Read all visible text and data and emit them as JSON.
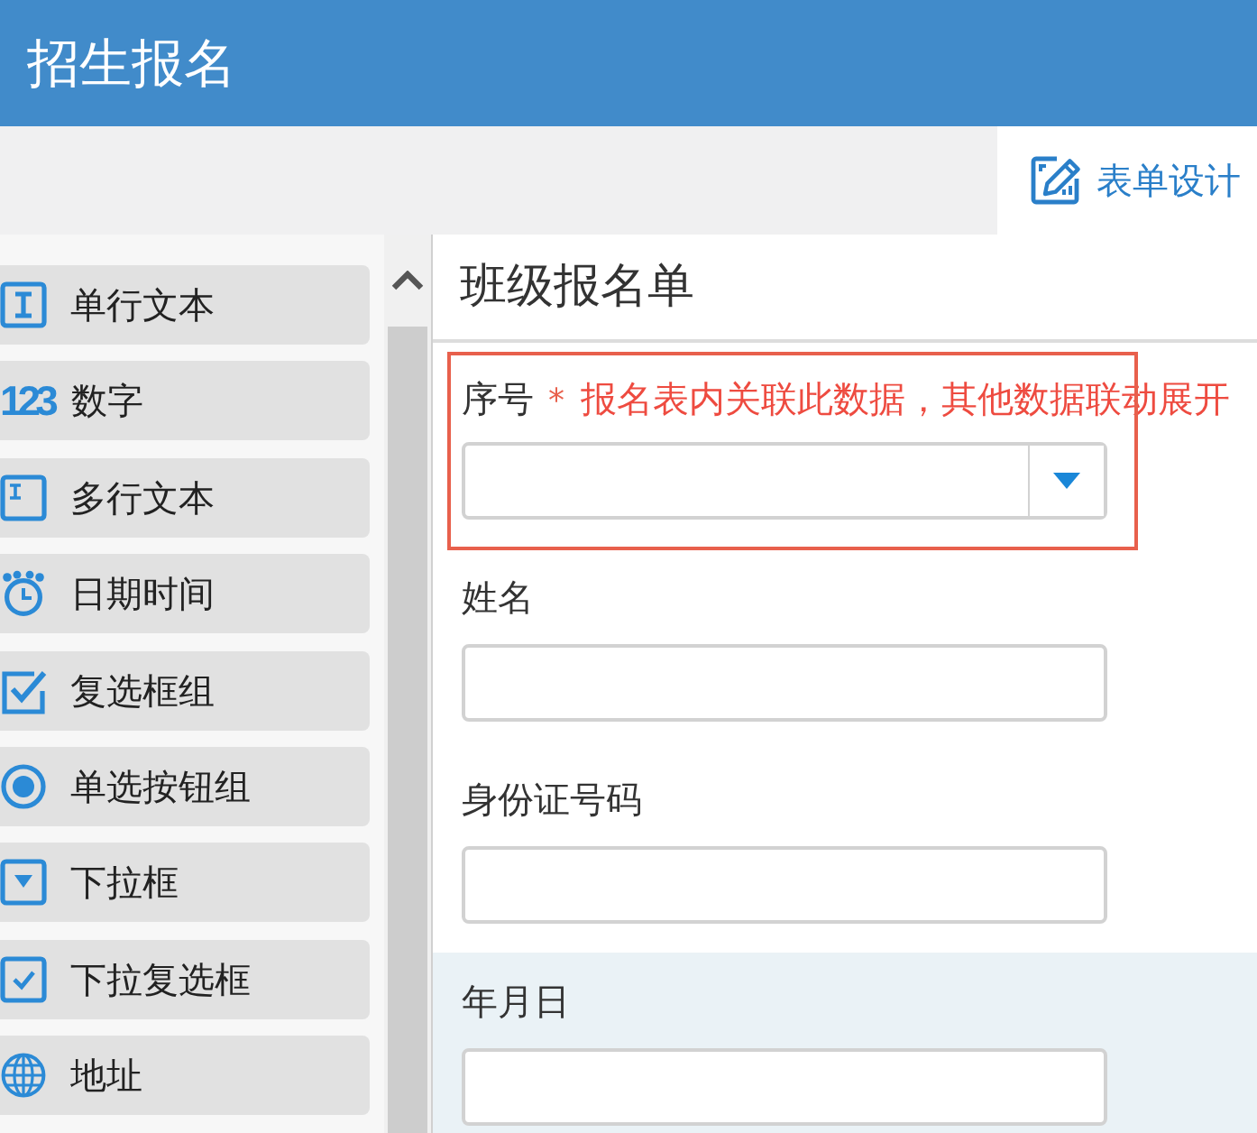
{
  "header": {
    "title": "招生报名"
  },
  "toolbar": {
    "tabs": [
      {
        "label": "表单设计",
        "selected": true
      }
    ]
  },
  "palette": {
    "items": [
      {
        "kind": "single-line-text",
        "label": "单行文本"
      },
      {
        "kind": "number",
        "icon_text": "123",
        "label": "数字"
      },
      {
        "kind": "multi-line-text",
        "label": "多行文本"
      },
      {
        "kind": "datetime",
        "label": "日期时间"
      },
      {
        "kind": "checkbox-group",
        "label": "复选框组"
      },
      {
        "kind": "radio-group",
        "label": "单选按钮组"
      },
      {
        "kind": "dropdown",
        "label": "下拉框"
      },
      {
        "kind": "dropdown-checkbox",
        "label": "下拉复选框"
      },
      {
        "kind": "address",
        "label": "地址"
      }
    ]
  },
  "form": {
    "title": "班级报名单",
    "fields": [
      {
        "kind": "select",
        "label": "序号",
        "required_mark": "*",
        "annotation": "报名表内关联此数据，其他数据联动展开",
        "highlighted": false
      },
      {
        "kind": "text",
        "label": "姓名",
        "highlighted": false
      },
      {
        "kind": "text",
        "label": "身份证号码",
        "highlighted": false
      },
      {
        "kind": "text",
        "label": "年月日",
        "highlighted": true
      }
    ]
  }
}
